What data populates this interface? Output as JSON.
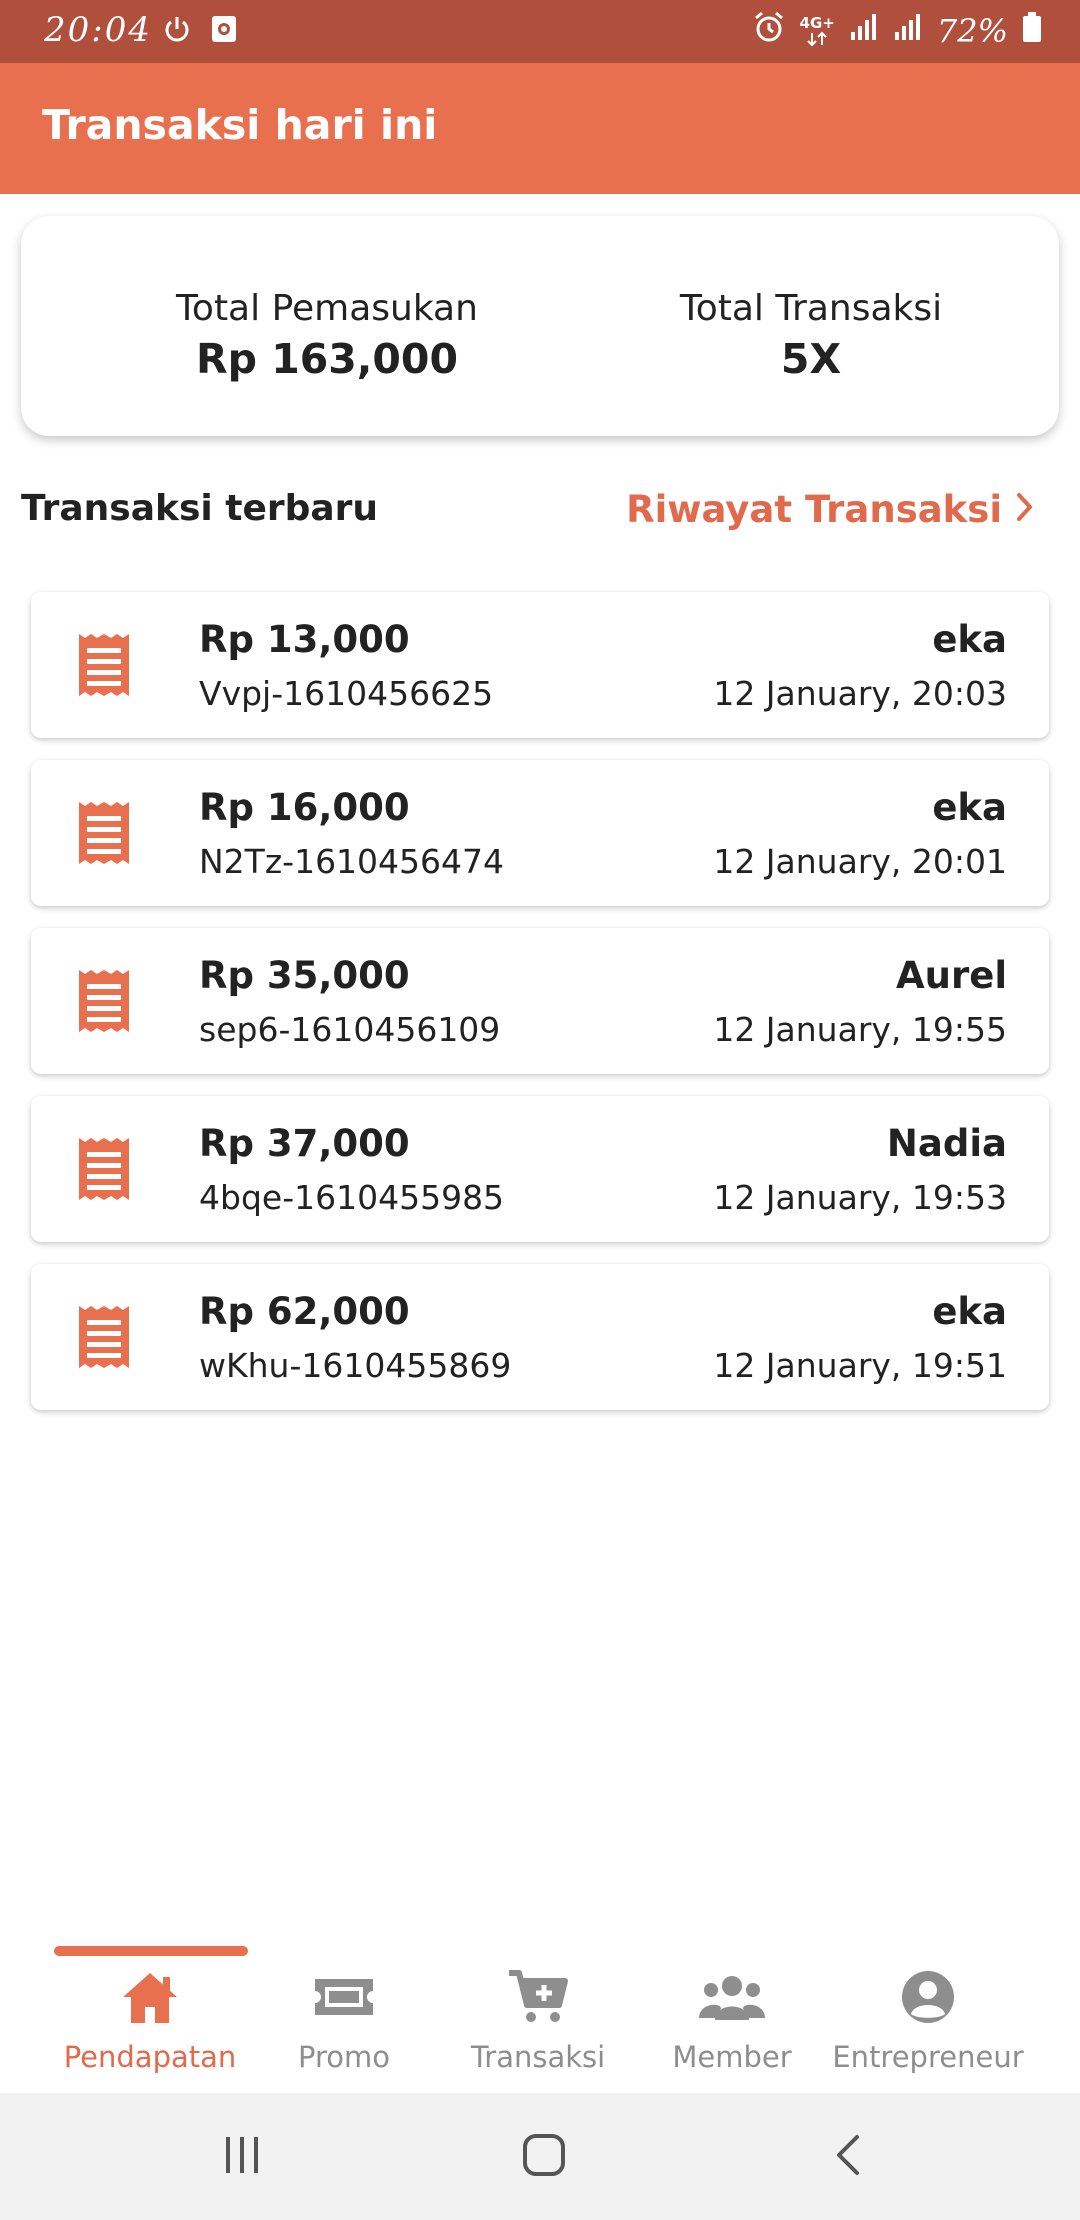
{
  "status_bar": {
    "time": "20:04",
    "network": "4G+",
    "battery": "72%",
    "icons": [
      "power-icon",
      "screen-record-icon",
      "alarm-icon",
      "network-icon",
      "signal-icon",
      "signal-icon",
      "battery-icon"
    ]
  },
  "app_bar": {
    "title": "Transaksi hari ini"
  },
  "summary": {
    "income_label": "Total Pemasukan",
    "income_value": "Rp 163,000",
    "count_label": "Total Transaksi",
    "count_value": "5X"
  },
  "section": {
    "title": "Transaksi terbaru",
    "history_link": "Riwayat Transaksi"
  },
  "transactions": [
    {
      "amount": "Rp 13,000",
      "code": "Vvpj-1610456625",
      "user": "eka",
      "time": "12 January, 20:03",
      "icon": "receipt-icon"
    },
    {
      "amount": "Rp 16,000",
      "code": "N2Tz-1610456474",
      "user": "eka",
      "time": "12 January, 20:01",
      "icon": "receipt-icon"
    },
    {
      "amount": "Rp 35,000",
      "code": "sep6-1610456109",
      "user": "Aurel",
      "time": "12 January, 19:55",
      "icon": "receipt-icon"
    },
    {
      "amount": "Rp 37,000",
      "code": "4bqe-1610455985",
      "user": "Nadia",
      "time": "12 January, 19:53",
      "icon": "receipt-icon"
    },
    {
      "amount": "Rp 62,000",
      "code": "wKhu-1610455869",
      "user": "eka",
      "time": "12 January, 19:51",
      "icon": "receipt-icon"
    }
  ],
  "bottom_nav": [
    {
      "label": "Pendapatan",
      "icon": "home-icon",
      "active": true
    },
    {
      "label": "Promo",
      "icon": "ticket-icon",
      "active": false
    },
    {
      "label": "Transaksi",
      "icon": "cart-add-icon",
      "active": false
    },
    {
      "label": "Member",
      "icon": "users-icon",
      "active": false
    },
    {
      "label": "Entrepreneur",
      "icon": "account-circle-icon",
      "active": false
    }
  ],
  "colors": {
    "status_bar": "#b0503c",
    "app_bar": "#e8704f",
    "accent": "#e06a4b",
    "inactive": "#8e8e8e"
  }
}
